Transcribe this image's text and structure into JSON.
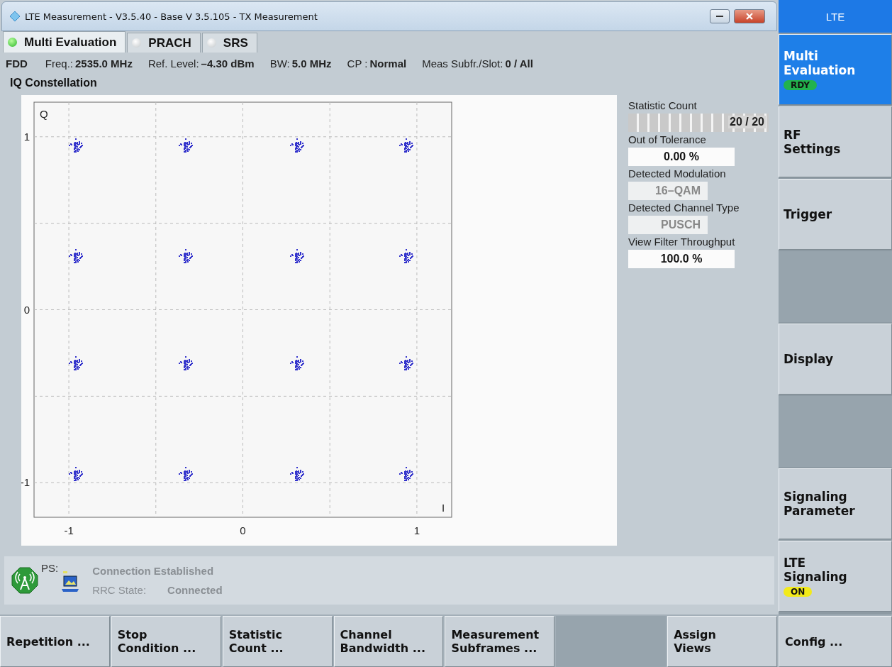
{
  "window": {
    "title": "LTE Measurement  - V3.5.40 - Base V 3.5.105 - TX Measurement"
  },
  "tabs": [
    {
      "label": "Multi Evaluation",
      "selected": true
    },
    {
      "label": "PRACH",
      "selected": false
    },
    {
      "label": "SRS",
      "selected": false
    }
  ],
  "info_bar": [
    {
      "label": "FDD"
    },
    {
      "label": "Freq.:",
      "value": "2535.0 MHz"
    },
    {
      "label": "Ref. Level:",
      "value": "–4.30 dBm"
    },
    {
      "label": "BW:",
      "value": "5.0 MHz"
    },
    {
      "label": "CP :",
      "value": "Normal"
    },
    {
      "label": "Meas Subfr./Slot:",
      "value": "0  / All"
    }
  ],
  "view": {
    "title": "IQ Constellation",
    "chart_data": {
      "type": "scatter",
      "grid": true,
      "xlabel": "I",
      "ylabel": "Q",
      "xlim": [
        -1.2,
        1.2
      ],
      "ylim": [
        -1.2,
        1.2
      ],
      "xticks": [
        -1,
        0,
        1
      ],
      "yticks": [
        -1,
        0,
        1
      ],
      "x": [
        -0.96,
        -0.33,
        0.31,
        0.94,
        -0.96,
        -0.33,
        0.31,
        0.94,
        -0.96,
        -0.33,
        0.31,
        0.94,
        -0.96,
        -0.33,
        0.31,
        0.94
      ],
      "values": [
        0.95,
        0.95,
        0.95,
        0.95,
        0.31,
        0.31,
        0.31,
        0.31,
        -0.31,
        -0.31,
        -0.31,
        -0.31,
        -0.95,
        -0.95,
        -0.95,
        -0.95
      ]
    }
  },
  "results": [
    {
      "kind": "meter",
      "label": "Statistic Count",
      "level": 1,
      "reading": "20 / 20"
    },
    {
      "kind": "value",
      "label": "Out of Tolerance",
      "value": "0.00  %",
      "disabled": false
    },
    {
      "kind": "value",
      "label": "Detected Modulation",
      "value": "16–QAM",
      "disabled": true
    },
    {
      "kind": "value",
      "label": "Detected Channel Type",
      "value": "PUSCH",
      "disabled": true
    },
    {
      "kind": "value",
      "label": "View Filter Throughput",
      "value": "100.0  %",
      "disabled": false
    }
  ],
  "status": {
    "ps_label": "PS:",
    "connection": "Connection Established",
    "rrc_label": "RRC State:",
    "rrc_value": "Connected"
  },
  "softkeys": {
    "header": "LTE",
    "items": [
      {
        "kind": "key",
        "label": "Multi\nEvaluation",
        "selected": true,
        "badge": {
          "text": "RDY",
          "color": "#22b24c"
        }
      },
      {
        "kind": "key",
        "label": "RF\nSettings",
        "selected": false
      },
      {
        "kind": "key",
        "label": "Trigger",
        "selected": false
      },
      {
        "kind": "empty"
      },
      {
        "kind": "key",
        "label": "Display",
        "selected": false
      },
      {
        "kind": "empty"
      },
      {
        "kind": "key",
        "label": "Signaling\nParameter",
        "selected": false
      },
      {
        "kind": "key",
        "label": "LTE\nSignaling",
        "selected": false,
        "badge": {
          "text": "ON",
          "color": "#f2ea1a"
        }
      }
    ]
  },
  "hotkeys": [
    {
      "kind": "key",
      "label": "Repetition ..."
    },
    {
      "kind": "key",
      "label": "Stop\nCondition ..."
    },
    {
      "kind": "key",
      "label": "Statistic\nCount ..."
    },
    {
      "kind": "key",
      "label": "Channel\nBandwidth ..."
    },
    {
      "kind": "key",
      "label": "Measurement\nSubframes ..."
    },
    {
      "kind": "empty"
    },
    {
      "kind": "key",
      "label": "Assign\nViews"
    },
    {
      "kind": "key",
      "label": "Config ..."
    }
  ]
}
